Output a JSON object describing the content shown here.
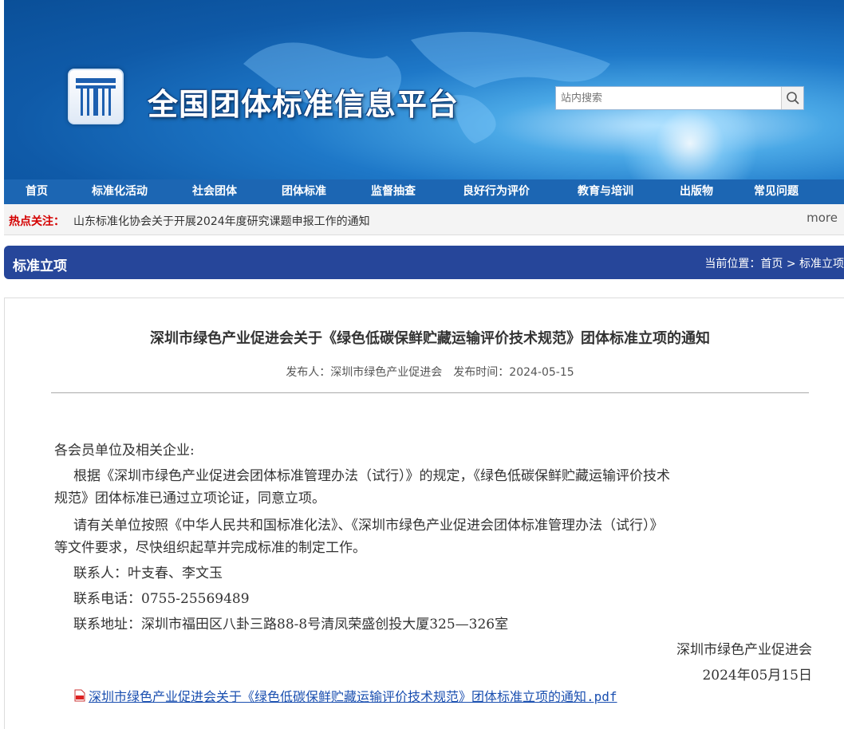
{
  "site": {
    "title": "全国团体标准信息平台"
  },
  "search": {
    "placeholder": "站内搜索"
  },
  "nav": {
    "items": [
      "首页",
      "标准化活动",
      "社会团体",
      "团体标准",
      "监督抽查",
      "良好行为评价",
      "教育与培训",
      "出版物",
      "常见问题"
    ]
  },
  "hot": {
    "label": "热点关注：",
    "text": "山东标准化协会关于开展2024年度研究课题申报工作的通知",
    "more": "more"
  },
  "section": {
    "title": "标准立项",
    "breadcrumb_prefix": "当前位置：",
    "breadcrumb_home": "首页",
    "breadcrumb_sep": ">",
    "breadcrumb_current": "标准立项"
  },
  "article": {
    "title": "深圳市绿色产业促进会关于《绿色低碳保鲜贮藏运输评价技术规范》团体标准立项的通知",
    "meta": "发布人：深圳市绿色产业促进会　发布时间：2024-05-15",
    "salutation": "各会员单位及相关企业:",
    "para1_line1": "根据《深圳市绿色产业促进会团体标准管理办法（试行）》的规定，《绿色低碳保鲜贮藏运输评价技术",
    "para1_line2": "规范》团体标准已通过立项论证，同意立项。",
    "para2_line1": "请有关单位按照《中华人民共和国标准化法》、《深圳市绿色产业促进会团体标准管理办法（试行）》",
    "para2_line2": "等文件要求，尽快组织起草并完成标准的制定工作。",
    "contact_person": "联系人：叶支春、李文玉",
    "contact_phone": "联系电话：0755-25569489",
    "contact_address": "联系地址：深圳市福田区八卦三路88-8号清凤荣盛创投大厦325—326室",
    "signature": "深圳市绿色产业促进会",
    "date": "2024年05月15日",
    "attachment": "深圳市绿色产业促进会关于《绿色低碳保鲜贮藏运输评价技术规范》团体标准立项的通知.pdf"
  },
  "colors": {
    "nav": "#1c66b3",
    "section": "#26469a",
    "hot_label": "#d40000",
    "link": "#1a4fb0"
  }
}
